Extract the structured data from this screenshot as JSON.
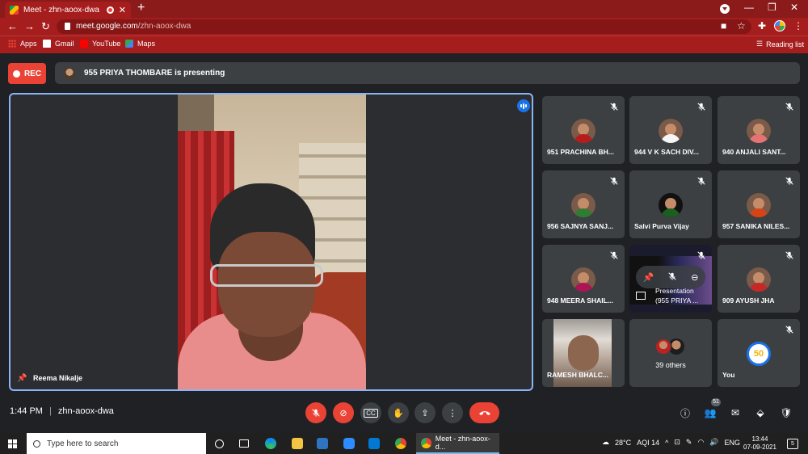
{
  "browser": {
    "tab_title": "Meet - zhn-aoox-dwa",
    "url_host": "meet.google.com",
    "url_path": "/zhn-aoox-dwa",
    "bookmarks": [
      {
        "label": "Apps",
        "icon": "apps-grid-icon"
      },
      {
        "label": "Gmail",
        "icon": "gmail-icon"
      },
      {
        "label": "YouTube",
        "icon": "youtube-icon"
      },
      {
        "label": "Maps",
        "icon": "maps-icon"
      }
    ],
    "reading_list": "Reading list",
    "theme_color": "#a61d1d"
  },
  "meet": {
    "rec_label": "REC",
    "presenting_banner": "955 PRIYA THOMBARE is presenting",
    "main_speaker": "Reema Nikalje",
    "accent": "#8ab4f8",
    "tiles": [
      {
        "name": "951 PRACHINA BH...",
        "muted": true
      },
      {
        "name": "944 V K SACH DIV...",
        "muted": true
      },
      {
        "name": "940 ANJALI SANT...",
        "muted": true
      },
      {
        "name": "956 SAJNYA SANJ...",
        "muted": true
      },
      {
        "name": "Salvi Purva Vijay",
        "muted": true
      },
      {
        "name": "957 SANIKA NILES...",
        "muted": true
      },
      {
        "name": "948 MEERA SHAIL...",
        "muted": true
      },
      {
        "name_line1": "Presentation",
        "name_line2": "(955 PRIYA ...",
        "muted": true
      },
      {
        "name": "909 AYUSH JHA",
        "muted": true
      },
      {
        "name": "RAMESH BHALC...",
        "muted": false
      },
      {
        "name": "39 others",
        "muted": false
      },
      {
        "name": "You",
        "muted": true,
        "logo_text": "50"
      }
    ],
    "time": "1:44 PM",
    "meeting_code": "zhn-aoox-dwa",
    "participant_count": "51"
  },
  "taskbar": {
    "search_placeholder": "Type here to search",
    "active_app": "Meet - zhn-aoox-d...",
    "weather": "28°C",
    "aqi": "AQI 14",
    "language": "ENG",
    "clock_time": "13:44",
    "clock_date": "07-09-2021",
    "notifications": "5"
  }
}
